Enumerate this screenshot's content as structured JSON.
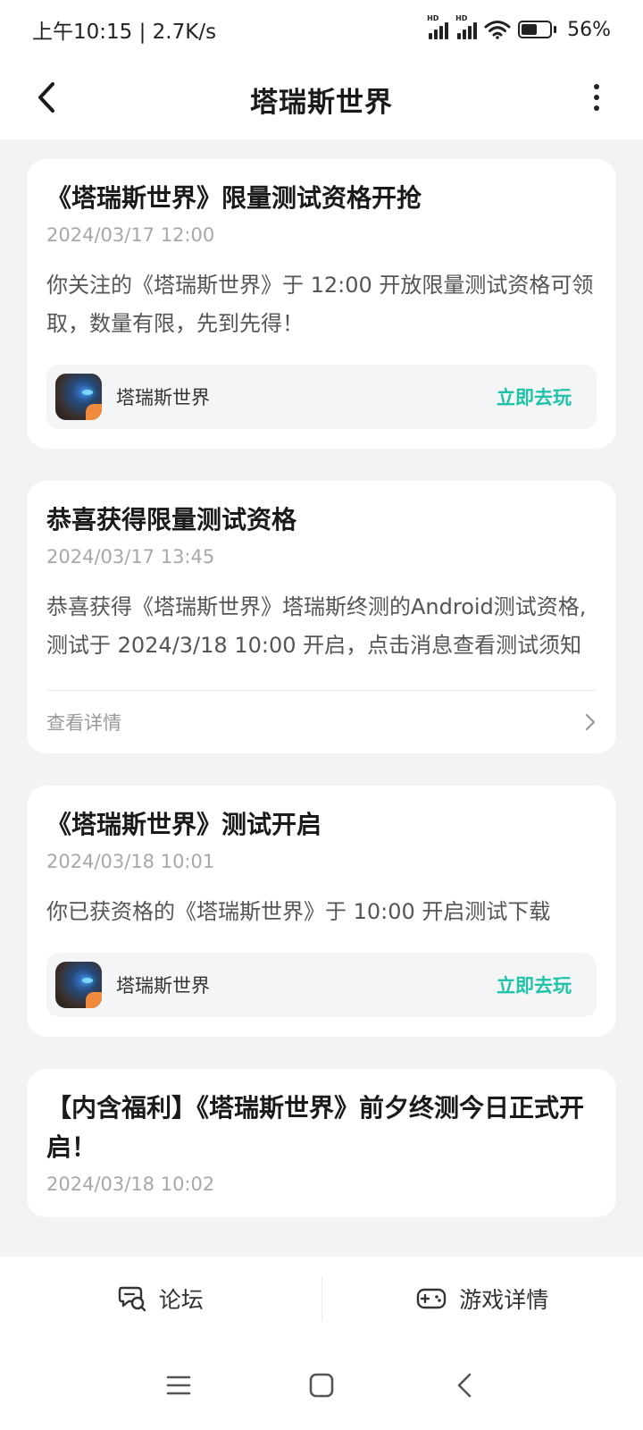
{
  "status_bar": {
    "time_speed": "上午10:15 | 2.7K/s",
    "signal_hd": "HD",
    "battery_percent": 56,
    "battery_text": "56%"
  },
  "header": {
    "title": "塔瑞斯世界",
    "back_icon": "chevron-left-icon",
    "more_icon": "more-vertical-icon"
  },
  "messages": [
    {
      "title": "《塔瑞斯世界》限量测试资格开抢",
      "time": "2024/03/17 12:00",
      "body": "你关注的《塔瑞斯世界》于 12:00 开放限量测试资格可领取，数量有限，先到先得！",
      "game_name": "塔瑞斯世界",
      "action_label": "立即去玩"
    },
    {
      "title": "恭喜获得限量测试资格",
      "time": "2024/03/17 13:45",
      "body": "恭喜获得《塔瑞斯世界》塔瑞斯终测的Android测试资格,测试于 2024/3/18 10:00 开启，点击消息查看测试须知",
      "detail_label": "查看详情"
    },
    {
      "title": "《塔瑞斯世界》测试开启",
      "time": "2024/03/18 10:01",
      "body": "你已获资格的《塔瑞斯世界》于 10:00 开启测试下载",
      "game_name": "塔瑞斯世界",
      "action_label": "立即去玩"
    },
    {
      "title": "【内含福利】《塔瑞斯世界》前夕终测今日正式开启！",
      "time": "2024/03/18 10:02"
    }
  ],
  "bottom_tabs": [
    {
      "label": "论坛",
      "icon": "forum-icon"
    },
    {
      "label": "游戏详情",
      "icon": "gamepad-icon"
    }
  ],
  "nav": {
    "menu_icon": "menu-icon",
    "home_icon": "home-square-icon",
    "back_icon": "nav-back-icon"
  },
  "colors": {
    "accent": "#20c3a8",
    "background": "#f2f3f5"
  }
}
